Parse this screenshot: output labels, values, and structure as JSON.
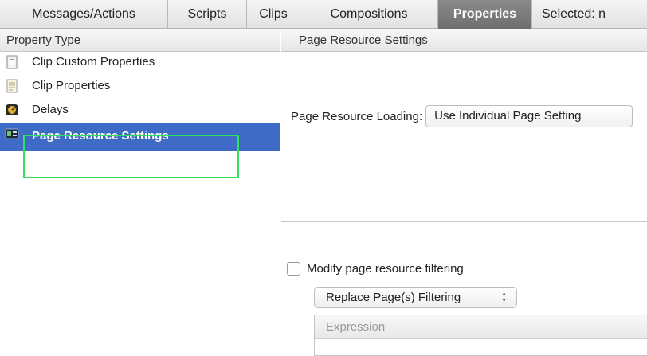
{
  "tabs": [
    {
      "label": "Messages/Actions",
      "active": false
    },
    {
      "label": "Scripts",
      "active": false
    },
    {
      "label": "Clips",
      "active": false
    },
    {
      "label": "Compositions",
      "active": false
    },
    {
      "label": "Properties",
      "active": true
    },
    {
      "label": "Selected: n",
      "active": false
    }
  ],
  "left_pane": {
    "header": "Property Type",
    "items": [
      {
        "label": "Clip Custom Properties",
        "icon": "document-icon"
      },
      {
        "label": "Clip Properties",
        "icon": "list-document-icon"
      },
      {
        "label": "Delays",
        "icon": "clock-icon"
      },
      {
        "label": "Page Resource Settings",
        "icon": "page-resource-icon",
        "selected": true
      }
    ]
  },
  "right_pane": {
    "header": "Page Resource Settings",
    "loading_label": "Page Resource Loading:",
    "loading_value": "Use Individual Page Setting",
    "modify_filtering_label": "Modify page resource filtering",
    "modify_filtering_checked": false,
    "filtering_select_value": "Replace Page(s) Filtering",
    "expression_header": "Expression"
  },
  "colors": {
    "selected_row": "#3e6bc6",
    "highlight_box": "#33e05a",
    "active_tab": "#7c7c7c"
  }
}
